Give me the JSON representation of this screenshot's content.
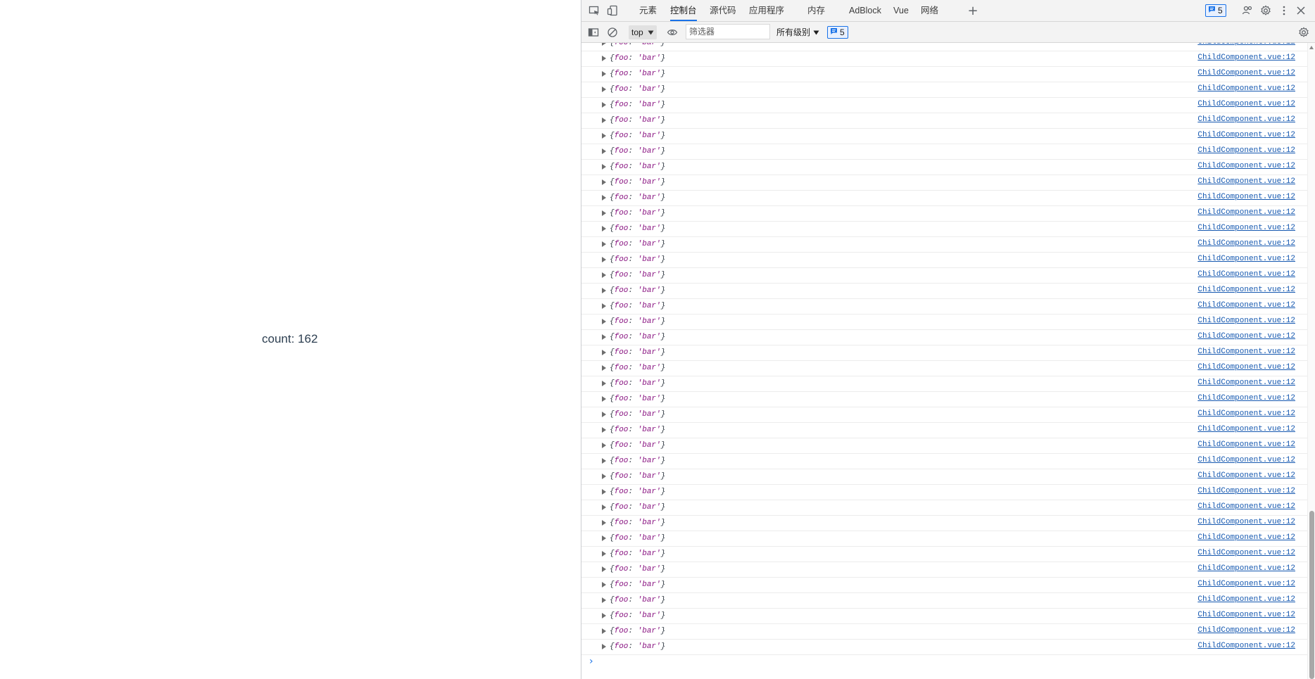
{
  "page": {
    "count_text": "count: 162"
  },
  "devtools": {
    "tabs": [
      {
        "label": "元素",
        "active": false
      },
      {
        "label": "控制台",
        "active": true
      },
      {
        "label": "源代码",
        "active": false
      },
      {
        "label": "应用程序",
        "active": false
      },
      {
        "label": "内存",
        "active": false
      },
      {
        "label": "AdBlock",
        "active": false
      },
      {
        "label": "Vue",
        "active": false
      },
      {
        "label": "网络",
        "active": false
      }
    ],
    "issues_count": "5",
    "toolbar": {
      "context": "top",
      "filter_placeholder": "筛选器",
      "levels": "所有级别",
      "issues_count": "5"
    },
    "console": {
      "log_entry": {
        "open": "{",
        "key": "foo",
        "sep": ": ",
        "value": "'bar'",
        "close": "}",
        "source": "ChildComponent.vue:12"
      },
      "visible_rows": 40
    },
    "icons": [
      "inspect-icon",
      "device-toggle-icon",
      "add-tab-icon",
      "issues-icon",
      "customize-icon",
      "settings-icon",
      "more-icon",
      "close-icon",
      "sidebar-icon",
      "clear-icon",
      "eye-icon",
      "console-settings-icon"
    ]
  }
}
